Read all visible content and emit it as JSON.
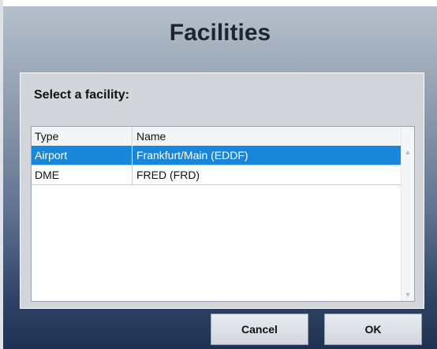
{
  "dialog": {
    "title": "Facilities",
    "prompt": "Select a facility:",
    "columns": {
      "type": "Type",
      "name": "Name"
    },
    "rows": [
      {
        "type": "Airport",
        "name": "Frankfurt/Main (EDDF)",
        "selected": true
      },
      {
        "type": "DME",
        "name": "FRED (FRD)",
        "selected": false
      }
    ],
    "buttons": {
      "cancel": "Cancel",
      "ok": "OK"
    }
  },
  "colors": {
    "selection": "#1a86da",
    "title_text": "#1f2430"
  },
  "icons": {
    "scroll_up": "chevron-up-icon",
    "scroll_down": "chevron-down-icon"
  }
}
